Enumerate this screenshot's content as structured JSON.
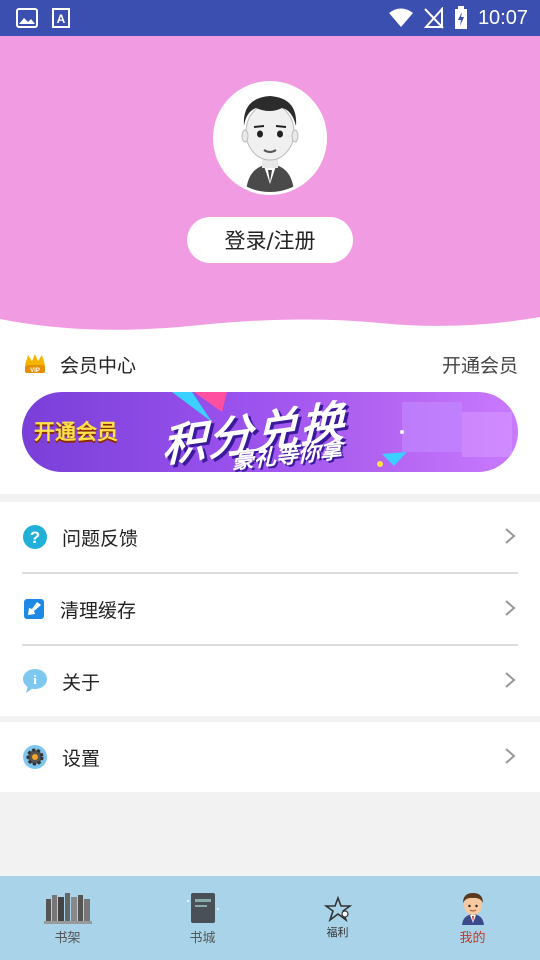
{
  "status_bar": {
    "time": "10:07"
  },
  "header": {
    "login_label": "登录/注册"
  },
  "vip": {
    "title": "会员中心",
    "action": "开通会员",
    "banner": {
      "pill": "开通会员",
      "headline": "积分兑换",
      "subline": "豪礼等你拿"
    }
  },
  "menu": [
    {
      "label": "问题反馈",
      "icon": "question-icon"
    },
    {
      "label": "清理缓存",
      "icon": "broom-icon"
    },
    {
      "label": "关于",
      "icon": "info-bubble-icon"
    },
    {
      "label": "设置",
      "icon": "gear-icon"
    }
  ],
  "bottom_nav": [
    {
      "label": "书架",
      "icon": "bookshelf-icon"
    },
    {
      "label": "书城",
      "icon": "book-icon"
    },
    {
      "label": "福利",
      "icon": "star-icon"
    },
    {
      "label": "我的",
      "icon": "profile-avatar-icon",
      "active": true
    }
  ],
  "colors": {
    "status_bar": "#3b4fb0",
    "header_pink": "#f19be3",
    "nav_bg": "#a9d3e8",
    "active_tab": "#c0392b"
  }
}
